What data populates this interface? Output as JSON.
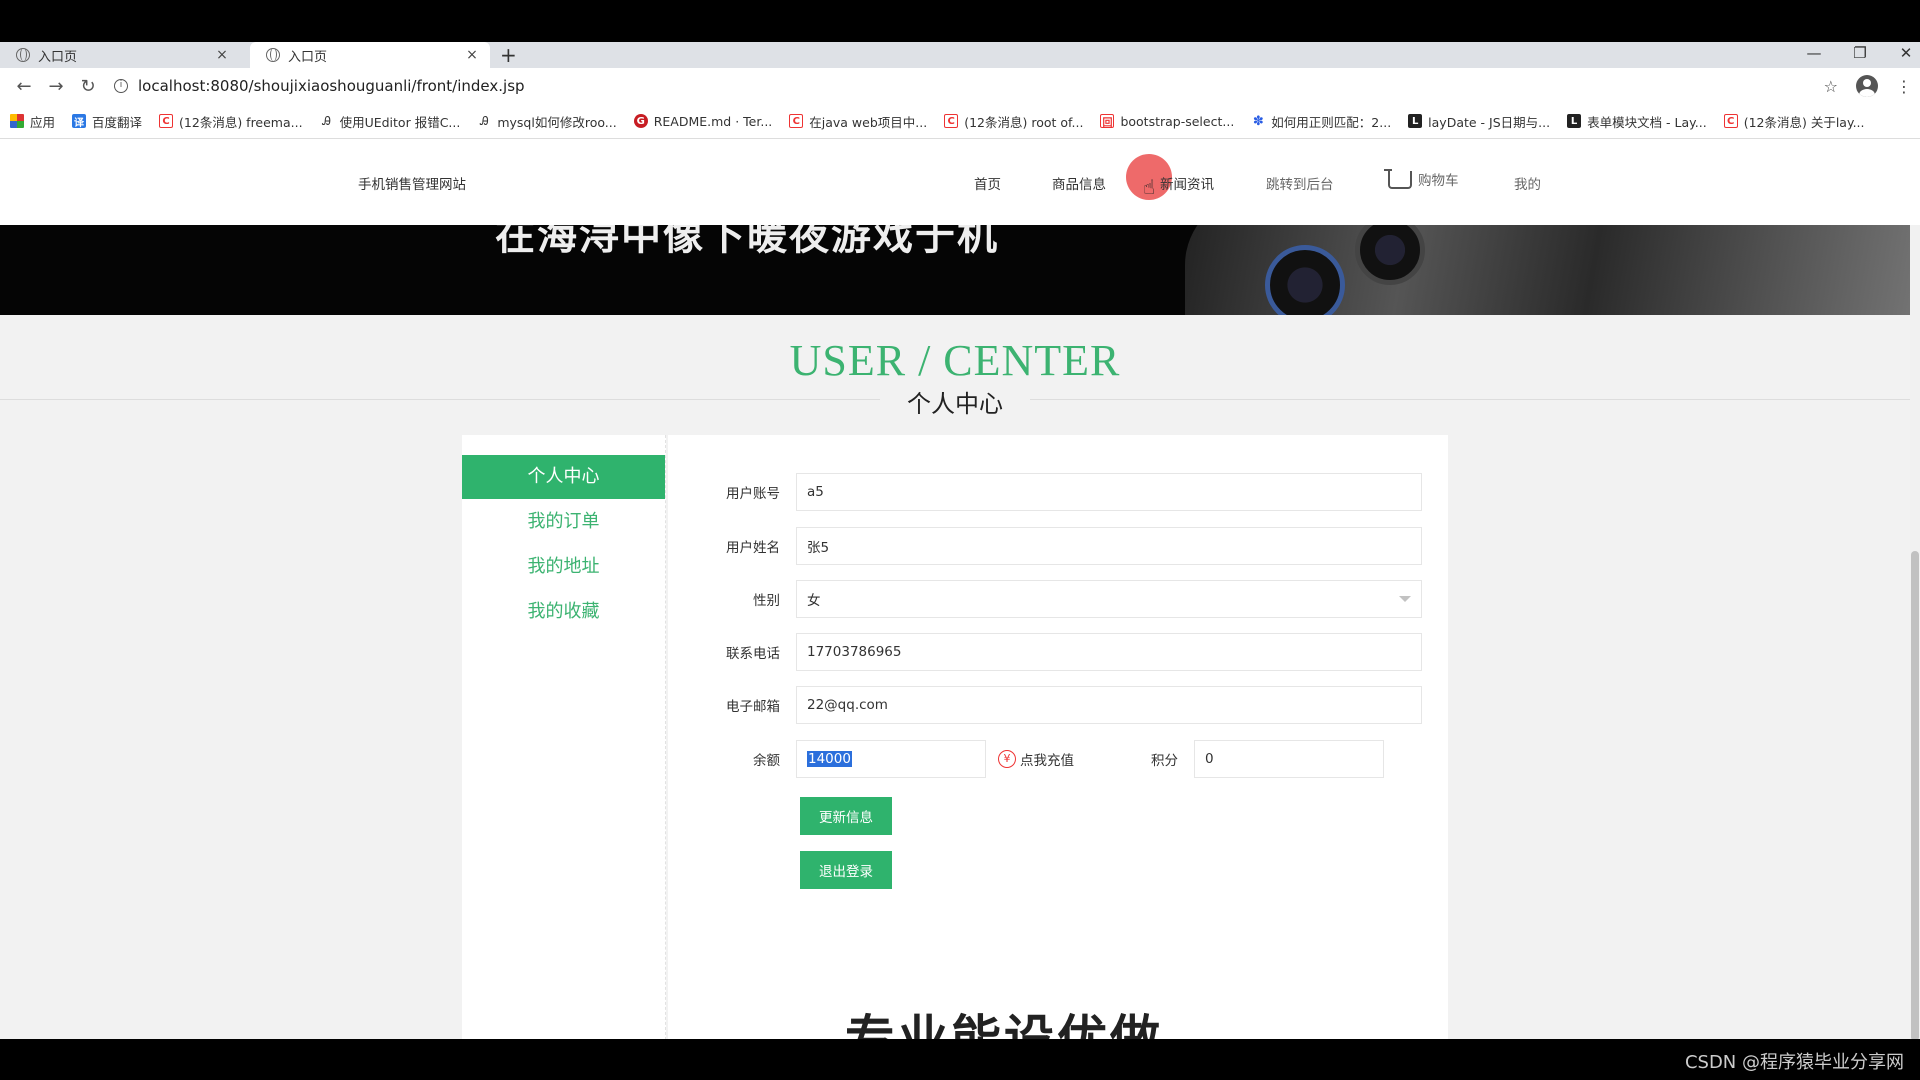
{
  "browser": {
    "tabs": [
      {
        "title": "入口页",
        "close": "×"
      },
      {
        "title": "入口页",
        "close": "×"
      }
    ],
    "new_tab": "+",
    "window_controls": {
      "minimize": "—",
      "restore": "❐",
      "close": "✕"
    },
    "nav": {
      "back": "←",
      "forward": "→",
      "reload": "↻"
    },
    "url": "localhost:8080/shoujixiaoshouguanli/front/index.jsp",
    "bookmark_star": "☆",
    "menu": "⋮",
    "bookmarks": [
      {
        "icon": "apps-icon",
        "label": "应用"
      },
      {
        "icon": "fanyi-icon",
        "label": "百度翻译"
      },
      {
        "icon": "csdn-icon",
        "label": "(12条消息) freema..."
      },
      {
        "icon": "a-icon",
        "label": "使用UEditor 报错C..."
      },
      {
        "icon": "a-icon",
        "label": "mysql如何修改roo..."
      },
      {
        "icon": "gitee-icon",
        "label": "README.md · Ter..."
      },
      {
        "icon": "csdn-icon",
        "label": "在java web项目中..."
      },
      {
        "icon": "csdn-icon",
        "label": "(12条消息) root of..."
      },
      {
        "icon": "bootstrap-icon",
        "label": "bootstrap-select..."
      },
      {
        "icon": "paw-icon",
        "label": "如何用正则匹配：2..."
      },
      {
        "icon": "lay-icon",
        "label": "layDate - JS日期与..."
      },
      {
        "icon": "lay-icon",
        "label": "表单模块文档 - Lay..."
      },
      {
        "icon": "csdn-icon",
        "label": "(12条消息) 关于lay..."
      }
    ]
  },
  "site": {
    "name": "手机销售管理网站",
    "nav": {
      "home": "首页",
      "products": "商品信息",
      "news": "新闻资讯",
      "backend": "跳转到后台",
      "cart": "购物车",
      "mine": "我的"
    }
  },
  "banner": {
    "text": "在海浔中像下暖夜游戏于机"
  },
  "section": {
    "title_en": "USER / CENTER",
    "title_cn": "个人中心"
  },
  "sidebar": {
    "items": [
      {
        "label": "个人中心",
        "active": true
      },
      {
        "label": "我的订单",
        "active": false
      },
      {
        "label": "我的地址",
        "active": false
      },
      {
        "label": "我的收藏",
        "active": false
      }
    ]
  },
  "form": {
    "account": {
      "label": "用户账号",
      "value": "a5"
    },
    "name": {
      "label": "用户姓名",
      "value": "张5"
    },
    "gender": {
      "label": "性别",
      "value": "女"
    },
    "phone": {
      "label": "联系电话",
      "value": "17703786965"
    },
    "email": {
      "label": "电子邮箱",
      "value": "22@qq.com"
    },
    "balance": {
      "label": "余额",
      "value": "14000",
      "recharge_label": "点我充值",
      "recharge_icon": "¥"
    },
    "points": {
      "label": "积分",
      "value": "0"
    },
    "update_button": "更新信息",
    "logout_button": "退出登录"
  },
  "bottom_text": "专业能设优做",
  "watermark": "CSDN @程序猿毕业分享网",
  "colors": {
    "accent": "#2fb36d",
    "title_green": "#3cb371"
  }
}
